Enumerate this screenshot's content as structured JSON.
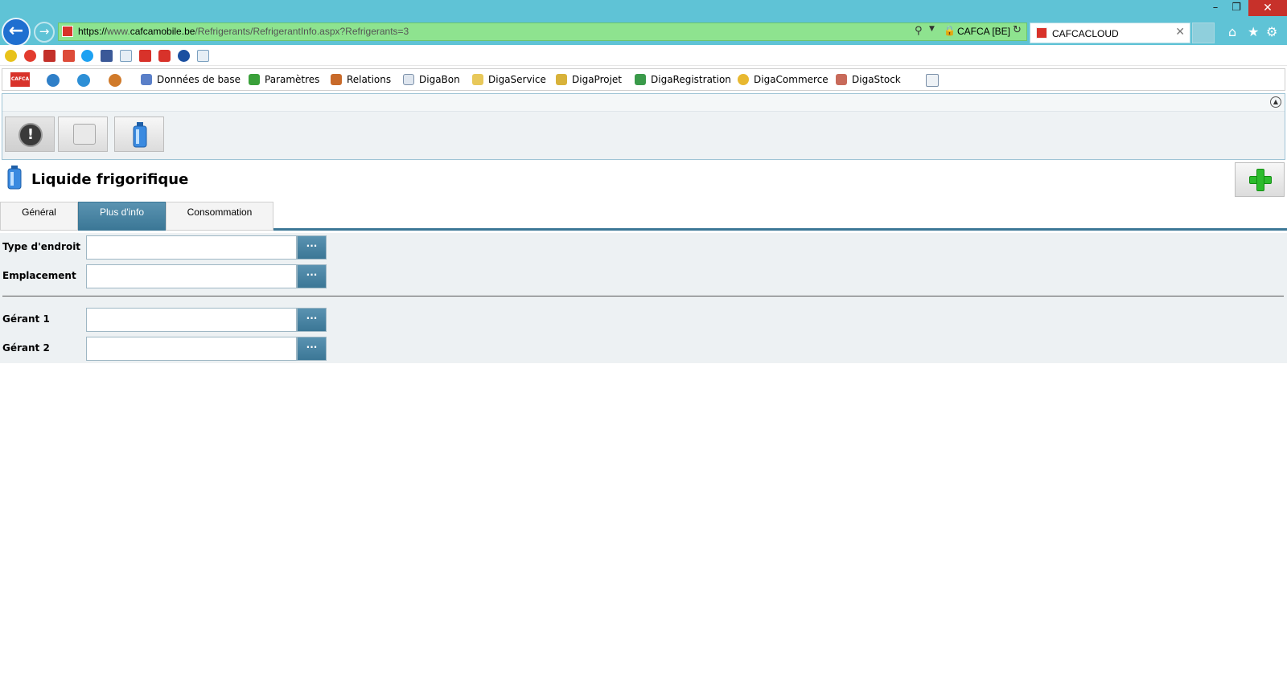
{
  "browser": {
    "url_scheme": "https://",
    "url_prefix": "www.",
    "url_host": "cafcamobile.be",
    "url_path": "/Refrigerants/RefrigerantInfo.aspx?Refrigerants=3",
    "site_identity": "CAFCA [BE]",
    "tab_title": "CAFCACLOUD",
    "icons": [
      "back-icon",
      "forward-icon",
      "search-icon",
      "lock-icon",
      "refresh-icon",
      "home-icon",
      "star-icon",
      "gear-icon"
    ]
  },
  "window_controls": {
    "minimize": "–",
    "maximize": "❐",
    "close": "✕"
  },
  "menubar": {
    "logo": "CAFCA",
    "items": [
      {
        "label": "Données de base"
      },
      {
        "label": "Paramètres"
      },
      {
        "label": "Relations"
      },
      {
        "label": "DigaBon"
      },
      {
        "label": "DigaService"
      },
      {
        "label": "DigaProjet"
      },
      {
        "label": "DigaRegistration"
      },
      {
        "label": "DigaCommerce"
      },
      {
        "label": "DigaStock"
      }
    ]
  },
  "toolbar": {
    "alert_glyph": "!",
    "collapse_glyph": "▲"
  },
  "page": {
    "title": "Liquide frigorifique",
    "add_button_icon": "plus-icon"
  },
  "tabs": [
    {
      "label": "Général",
      "active": false
    },
    {
      "label": "Plus d'info",
      "active": true
    },
    {
      "label": "Consommation",
      "active": false
    }
  ],
  "form": {
    "fields": [
      {
        "label": "Type d'endroit",
        "value": "",
        "button": "···"
      },
      {
        "label": "Emplacement",
        "value": "",
        "button": "···"
      },
      {
        "label": "Gérant 1",
        "value": "",
        "button": "···"
      },
      {
        "label": "Gérant 2",
        "value": "",
        "button": "···"
      }
    ]
  },
  "colors": {
    "titlebar": "#5fc3d6",
    "address_bar": "#8ee38f",
    "accent": "#3b7796",
    "add_green": "#2dbb2d"
  }
}
